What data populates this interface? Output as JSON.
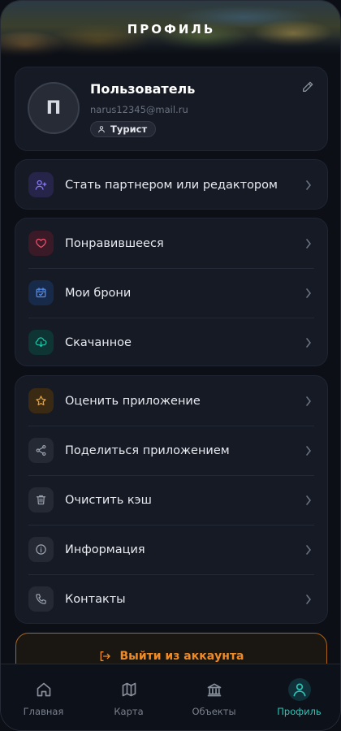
{
  "header": {
    "title": "ПРОФИЛЬ"
  },
  "profile": {
    "avatar_initial": "П",
    "name": "Пользователь",
    "email": "narus12345@mail.ru",
    "role": "Турист",
    "edit_icon": "pencil-icon"
  },
  "partner": {
    "label": "Стать партнером или редактором",
    "icon": "user-plus-icon",
    "color": "#8b7cf6"
  },
  "personal": [
    {
      "label": "Понравившееся",
      "icon": "heart-icon",
      "color": "#ef4f6a"
    },
    {
      "label": "Мои брони",
      "icon": "calendar-check-icon",
      "color": "#4f8df5"
    },
    {
      "label": "Скачанное",
      "icon": "cloud-download-icon",
      "color": "#22c1a6"
    }
  ],
  "app": [
    {
      "label": "Оценить приложение",
      "icon": "star-icon",
      "color": "#f0a12a"
    },
    {
      "label": "Поделиться приложением",
      "icon": "share-icon",
      "color": "#9aa1ad"
    },
    {
      "label": "Очистить кэш",
      "icon": "trash-icon",
      "color": "#9aa1ad"
    },
    {
      "label": "Информация",
      "icon": "info-icon",
      "color": "#9aa1ad"
    },
    {
      "label": "Контакты",
      "icon": "phone-icon",
      "color": "#9aa1ad"
    }
  ],
  "logout": {
    "label": "Выйти из аккаунта",
    "icon": "logout-icon",
    "color": "#f08a24"
  },
  "tabs": [
    {
      "label": "Главная",
      "icon": "home-icon",
      "active": false
    },
    {
      "label": "Карта",
      "icon": "map-icon",
      "active": false
    },
    {
      "label": "Объекты",
      "icon": "museum-icon",
      "active": false
    },
    {
      "label": "Профиль",
      "icon": "user-icon",
      "active": true
    }
  ],
  "colors": {
    "accent": "#2ec4b6",
    "background": "#0c0f16",
    "card": "#151a24",
    "danger": "#f08a24"
  }
}
